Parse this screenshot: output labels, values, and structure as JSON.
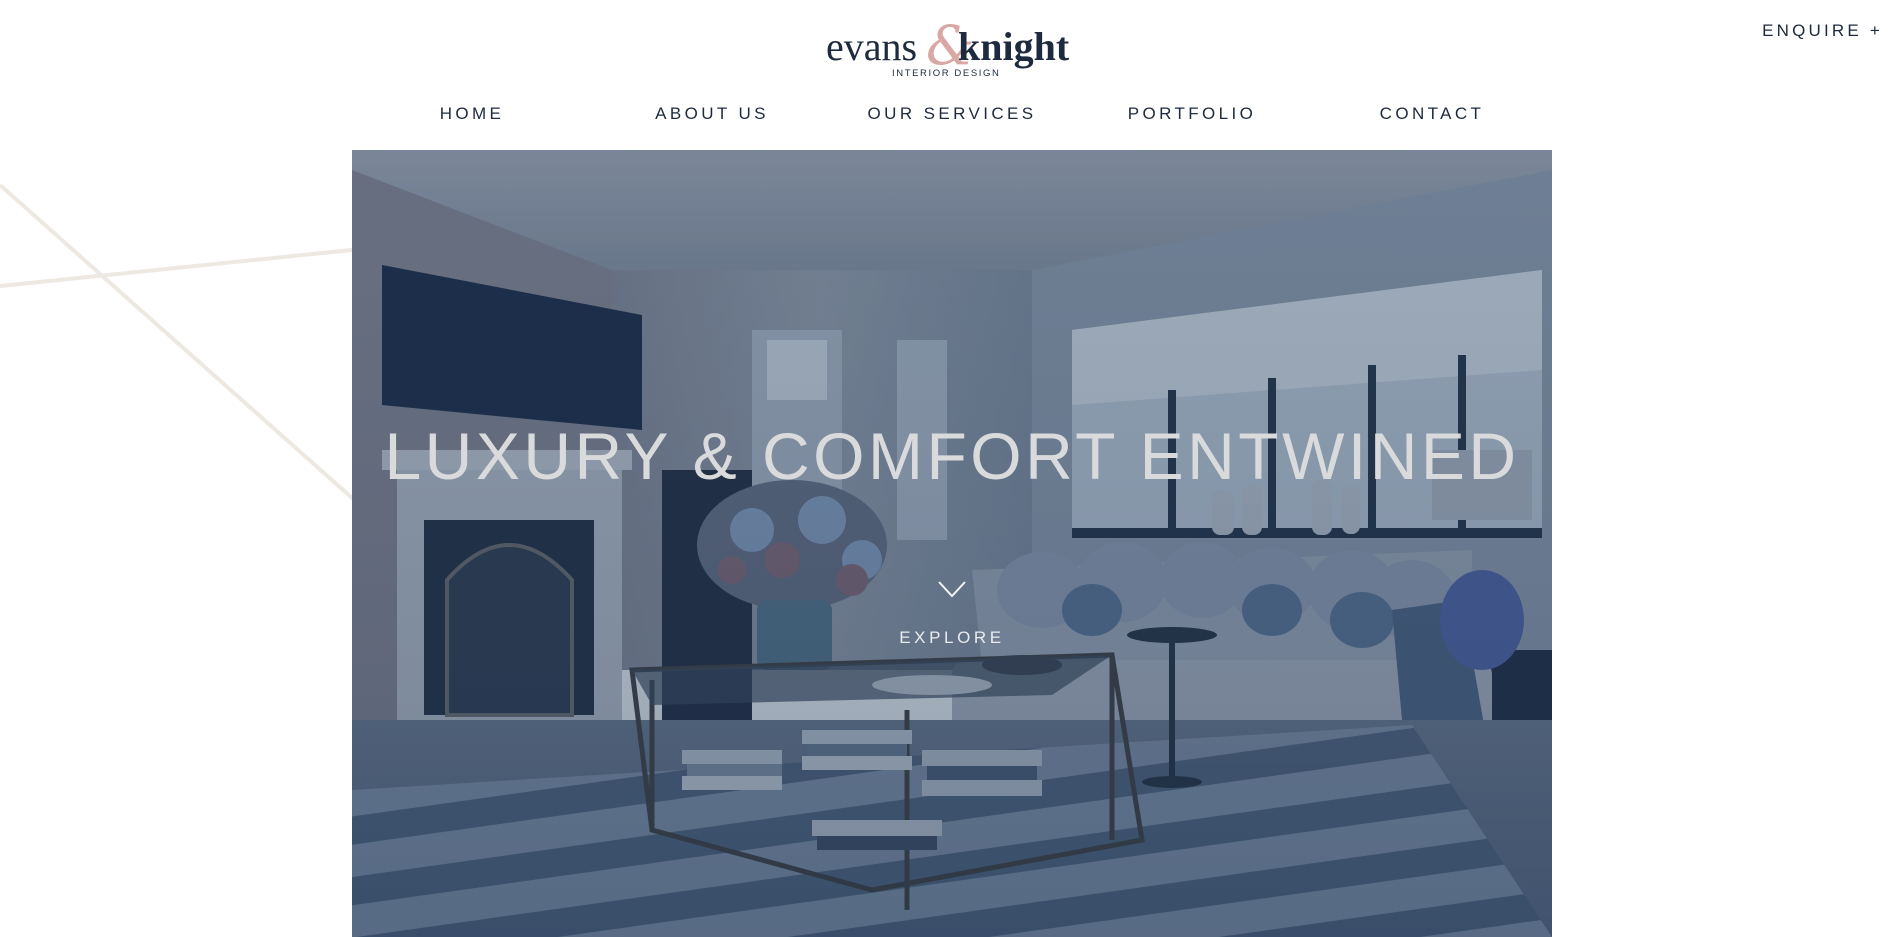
{
  "header": {
    "logo": {
      "wordmark_left": "evans",
      "ampersand": "&",
      "wordmark_right": "knight",
      "tagline": "INTERIOR DESIGN"
    },
    "enquire_label": "ENQUIRE +"
  },
  "nav": {
    "items": [
      {
        "label": "HOME"
      },
      {
        "label": "ABOUT US"
      },
      {
        "label": "OUR SERVICES"
      },
      {
        "label": "PORTFOLIO"
      },
      {
        "label": "CONTACT"
      }
    ]
  },
  "hero": {
    "title": "LUXURY & COMFORT ENTWINED",
    "explore_label": "EXPLORE"
  },
  "colors": {
    "text_dark": "#1e2a3d",
    "accent_pink": "#d9a8a4",
    "hero_overlay": "#2b4766",
    "hero_title": "#d9dadb"
  }
}
